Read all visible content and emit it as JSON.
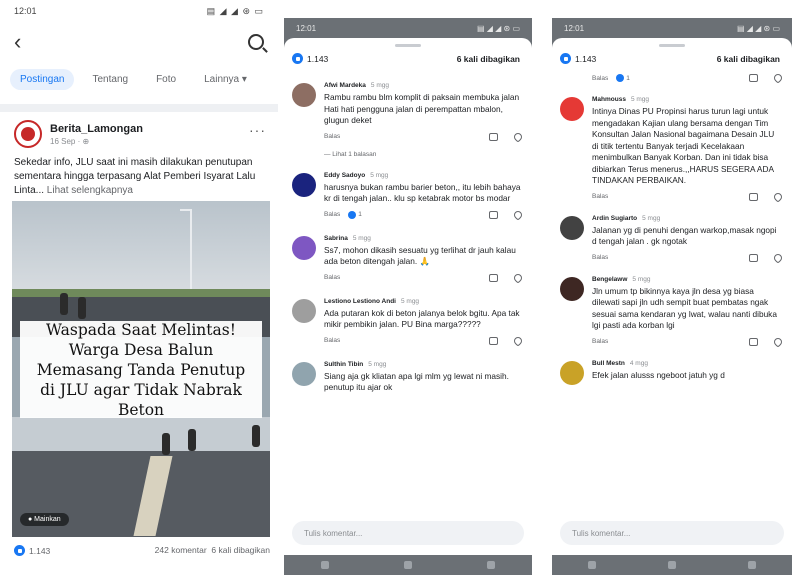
{
  "panel1": {
    "status_time": "12:01",
    "status_icons": "▤ ◢ ◢ ⊛ ▭",
    "tabs": [
      {
        "label": "Postingan",
        "active": true
      },
      {
        "label": "Tentang"
      },
      {
        "label": "Foto"
      },
      {
        "label": "Lainnya ▾"
      }
    ],
    "page_name": "Berita_Lamongan",
    "post_time": "16 Sep · ⊕",
    "caption": "Sekedar info, JLU saat ini masih dilakukan penutupan sementara hingga terpasang  Alat Pemberi Isyarat Lalu Linta...",
    "see_more": " Lihat selengkapnya",
    "overlay_text": "Waspada Saat Melintas! Warga Desa Balun Memasang Tanda Penutup di JLU agar Tidak Nabrak Beton",
    "video_badge": "● Mainkan",
    "reaction_count": "1.143",
    "comments_count": "242 komentar",
    "shares_count": "6 kali dibagikan"
  },
  "panel2": {
    "status_time": "12:01",
    "reaction_count": "1.143",
    "shares": "6 kali dibagikan",
    "comments": [
      {
        "name": "Afwi Mardeka",
        "time": "5 mgg",
        "text": "Rambu rambu blm komplit di paksain membuka jalan\nHati hati pengguna jalan di perempattan mbalon, glugun deket",
        "reply": "Balas",
        "likes": "",
        "view_replies": "— Lihat 1 balasan",
        "avatar_color": "#8d6e63"
      },
      {
        "name": "Eddy Sadoyo",
        "time": "5 mgg",
        "text": "harusnya bukan rambu barier beton,, itu lebih bahaya kr di tengah jalan.. klu sp ketabrak motor bs modar",
        "reply": "Balas",
        "likes": "1",
        "view_replies": "",
        "avatar_color": "#1a237e"
      },
      {
        "name": "Sabrina",
        "time": "5 mgg",
        "text": "Ss7, mohon dikasih sesuatu yg terlihat dr jauh kalau ada beton ditengah jalan. 🙏",
        "reply": "Balas",
        "likes": "",
        "view_replies": "",
        "avatar_color": "#7e57c2"
      },
      {
        "name": "Lestiono Lestiono Andi",
        "time": "5 mgg",
        "text": "Ada putaran kok di beton jalanya belok bgitu. Apa tak mikir pembikin jalan. PU Bina marga?????",
        "reply": "Balas",
        "likes": "",
        "view_replies": "",
        "avatar_color": "#9e9e9e"
      },
      {
        "name": "Sulthin Tibin",
        "time": "5 mgg",
        "text": "Siang aja gk kliatan apa lgi mlm yg lewat ni masih. penutup itu ajar ok",
        "reply": "",
        "likes": "",
        "view_replies": "",
        "avatar_color": "#90a4ae"
      }
    ],
    "input_placeholder": "Tulis komentar..."
  },
  "panel3": {
    "status_time": "12:01",
    "reaction_count": "1.143",
    "shares": "6 kali dibagikan",
    "top_reply": "Balas",
    "top_likes": "1",
    "comments": [
      {
        "name": "Mahmouss",
        "time": "5 mgg",
        "text": "Intinya Dinas PU Propinsi harus turun lagi untuk mengadakan Kajian ulang bersama  dengan Tim Konsultan Jalan Nasional bagaimana Desain JLU di titik tertentu Banyak terjadi Kecelakaan menimbulkan Banyak Korban.  Dan ini tidak bisa dibiarkan Terus menerus.,,HARUS SEGERA ADA TINDAKAN PERBAIKAN.",
        "reply": "Balas",
        "avatar_color": "#e53935"
      },
      {
        "name": "Ardin Sugiarto",
        "time": "5 mgg",
        "text": "Jalanan yg di penuhi dengan warkop,masak ngopi d tengah jalan . gk ngotak",
        "reply": "Balas",
        "avatar_color": "#424242"
      },
      {
        "name": "Bengelaww",
        "time": "5 mgg",
        "text": "Jln umum tp bikinnya kaya jln desa yg biasa dilewati sapi jln udh sempit buat pembatas ngak sesuai sama kendaran yg lwat, walau nanti dibuka lgi pasti ada korban lgi",
        "reply": "Balas",
        "avatar_color": "#3e2723"
      },
      {
        "name": "Bull Mestn",
        "time": "4 mgg",
        "text": "Efek jalan alusss ngeboot jatuh yg d",
        "reply": "",
        "avatar_color": "#c9a227"
      }
    ],
    "input_placeholder": "Tulis komentar..."
  }
}
